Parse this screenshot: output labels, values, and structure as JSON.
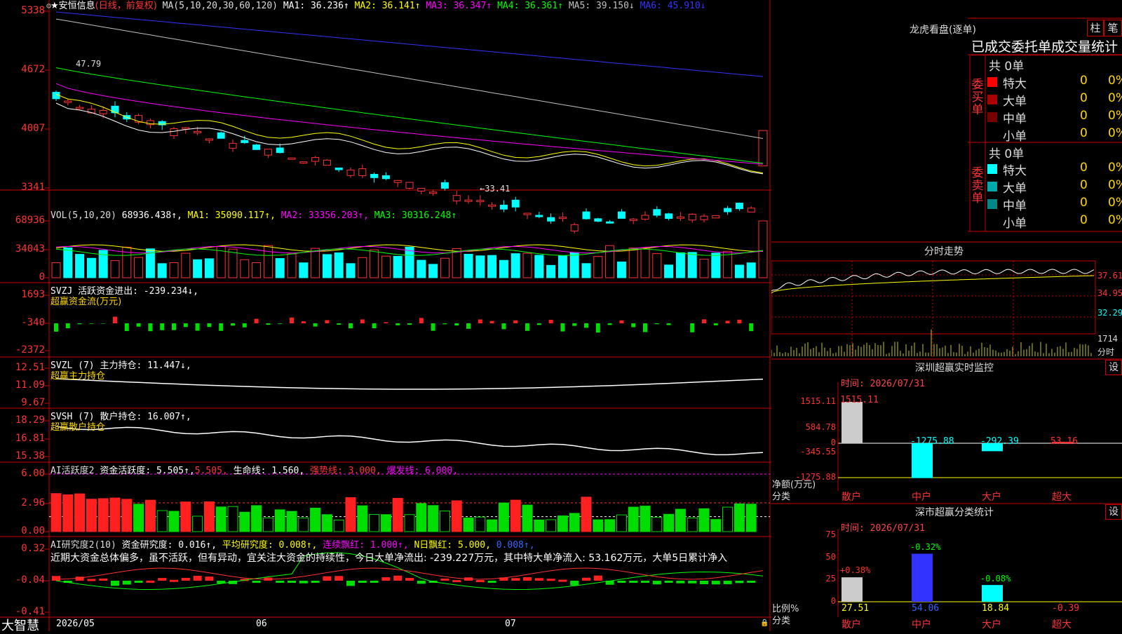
{
  "stock": {
    "name": "★安恒信息",
    "mode": "(日线，前复权)",
    "ma_params": "MA(5,10,20,30,60,120)",
    "ma": [
      {
        "label": "MA1:",
        "value": "36.236↑",
        "color": "#ffffff"
      },
      {
        "label": "MA2:",
        "value": "36.141↑",
        "color": "#ffff00"
      },
      {
        "label": "MA3:",
        "value": "36.347↑",
        "color": "#ff00ff"
      },
      {
        "label": "MA4:",
        "value": "36.361↑",
        "color": "#00ff00"
      },
      {
        "label": "MA5:",
        "value": "39.150↓",
        "color": "#c0c0c0"
      },
      {
        "label": "MA6:",
        "value": "45.910↓",
        "color": "#3333ff"
      }
    ],
    "price_axis": [
      "5338",
      "4672",
      "4007",
      "3341"
    ],
    "high_mark": "47.79",
    "low_mark": "←33.41"
  },
  "vol": {
    "params": "VOL(5,10,20)",
    "value": "68936.438↑,",
    "ma": [
      {
        "label": "MA1:",
        "value": "35090.117↑,",
        "color": "#ffff00"
      },
      {
        "label": "MA2:",
        "value": "33356.203↑,",
        "color": "#ff00ff"
      },
      {
        "label": "MA3:",
        "value": "30316.248↑",
        "color": "#00ff00"
      }
    ],
    "axis": [
      "68936",
      "34043",
      "0"
    ]
  },
  "svzj": {
    "header": "SVZJ  活跃资金进出: -239.234↓,",
    "title": "超赢资金流(万元)",
    "axis": [
      "1693",
      "-340",
      "-2372"
    ]
  },
  "svzl": {
    "header": "SVZL (7) 主力持仓: 11.447↓,",
    "title": "超赢主力持仓",
    "axis": [
      "12.51",
      "11.09",
      "9.67"
    ]
  },
  "svsh": {
    "header": "SVSH (7) 散户持仓: 16.007↑,",
    "title": "超赢散户持仓",
    "axis": [
      "18.29",
      "16.81",
      "15.38"
    ]
  },
  "ai_active": {
    "name": "AI活跃度2",
    "label1": "资金活跃度: 5.505↑,",
    "label2": "5.505,",
    "label3": "生命线: 1.560,",
    "label4": "强势线: 3.000,",
    "label5": "爆发线: 6.000,",
    "axis": [
      "6.00",
      "2.96",
      "0.00"
    ]
  },
  "ai_research": {
    "name": "AI研究度2(10)",
    "label1": "资金研究度: 0.016↑,",
    "label2": "平均研究度: 0.008↑,",
    "label3": "连续飘红: 1.000↑,",
    "label4": "N日飘红: 5.000,",
    "label5": "0.008↑,",
    "comment": "近期大资金总体偏多，虽不活跃，但有异动，宜关注大资金的持续性，今日大单净流出: -239.227万元，其中特大单净流入: 53.162万元，大单5日累计净入",
    "axis": [
      "0.32",
      "-0.04",
      "-0.41"
    ]
  },
  "bottom": {
    "logo": "大智慧",
    "dates": [
      "2026/05",
      "06",
      "07"
    ]
  },
  "longhu": {
    "title": "龙虎看盘(逐单)",
    "btn_zhu": "柱",
    "btn_bi": "笔",
    "header": "已成交委托单成交量统计",
    "buy_label": "委买单",
    "sell_label": "委卖单",
    "buy_total": "共 0单",
    "sell_total": "共 0单",
    "buy_rows": [
      {
        "name": "特大",
        "count": "0",
        "pct": "0%",
        "color": "#ff0000"
      },
      {
        "name": "大单",
        "count": "0",
        "pct": "0%",
        "color": "#aa0000"
      },
      {
        "name": "中单",
        "count": "0",
        "pct": "0%",
        "color": "#770000"
      },
      {
        "name": "小单",
        "count": "0",
        "pct": "0%",
        "color": "#000000"
      }
    ],
    "sell_rows": [
      {
        "name": "特大",
        "count": "0",
        "pct": "0%",
        "color": "#00ffff"
      },
      {
        "name": "大单",
        "count": "0",
        "pct": "0%",
        "color": "#00aaaa"
      },
      {
        "name": "中单",
        "count": "0",
        "pct": "0%",
        "color": "#008888"
      },
      {
        "name": "小单",
        "count": "0",
        "pct": "0%",
        "color": "#000000"
      }
    ]
  },
  "fenshi": {
    "title": "分时走势",
    "axis": [
      "37.61",
      "34.95",
      "32.29"
    ],
    "vol_axis": [
      "1714",
      "分时"
    ]
  },
  "monitor": {
    "title": "深圳超赢实时监控",
    "btn": "设",
    "time": "时间: 2026/07/31",
    "axis": [
      "1515.11",
      "584.78",
      "0",
      "-345.55",
      "-1275.88"
    ],
    "unit1": "净额(万元)",
    "unit2": "分类",
    "bars": [
      {
        "cat": "散户",
        "value": "1515.11"
      },
      {
        "cat": "中户",
        "value": "-1275.88"
      },
      {
        "cat": "大户",
        "value": "-292.39"
      },
      {
        "cat": "超大",
        "value": "53.16"
      }
    ]
  },
  "classify": {
    "title": "深市超赢分类统计",
    "btn": "设",
    "time": "时间: 2026/07/31",
    "axis": [
      "75",
      "50",
      "25",
      "0"
    ],
    "unit1": "比例%",
    "unit2": "分类",
    "bars": [
      {
        "cat": "散户",
        "change": "+0.38%",
        "value": "27.51"
      },
      {
        "cat": "中户",
        "change": "-0.32%",
        "value": "54.06"
      },
      {
        "cat": "大户",
        "change": "-0.08%",
        "value": "18.84"
      },
      {
        "cat": "超大",
        "change": "",
        "value": "-0.39"
      }
    ]
  }
}
